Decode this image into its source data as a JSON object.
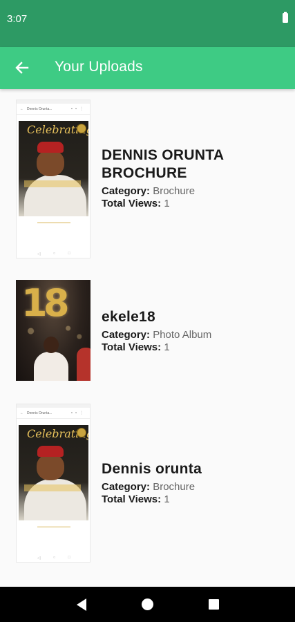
{
  "status_bar": {
    "time": "3:07"
  },
  "app_bar": {
    "title": "Your Uploads"
  },
  "labels": {
    "category": "Category:",
    "total_views": "Total Views:"
  },
  "uploads": [
    {
      "title": "DENNIS ORUNTA BROCHURE",
      "category": "Brochure",
      "views": "1",
      "thumbnail": "brochure-screenshot"
    },
    {
      "title": "ekele18",
      "category": "Photo Album",
      "views": "1",
      "thumbnail": "photo"
    },
    {
      "title": "Dennis orunta",
      "category": "Brochure",
      "views": "1",
      "thumbnail": "brochure-screenshot"
    }
  ],
  "thumbnail_text": {
    "toolbar_title": "Dennis Oruntа...",
    "poster_script": "Celebrating",
    "balloon_one": "1",
    "balloon_eight": "8"
  },
  "colors": {
    "status_bar": "#2d9a64",
    "app_bar": "#3ecb84"
  }
}
